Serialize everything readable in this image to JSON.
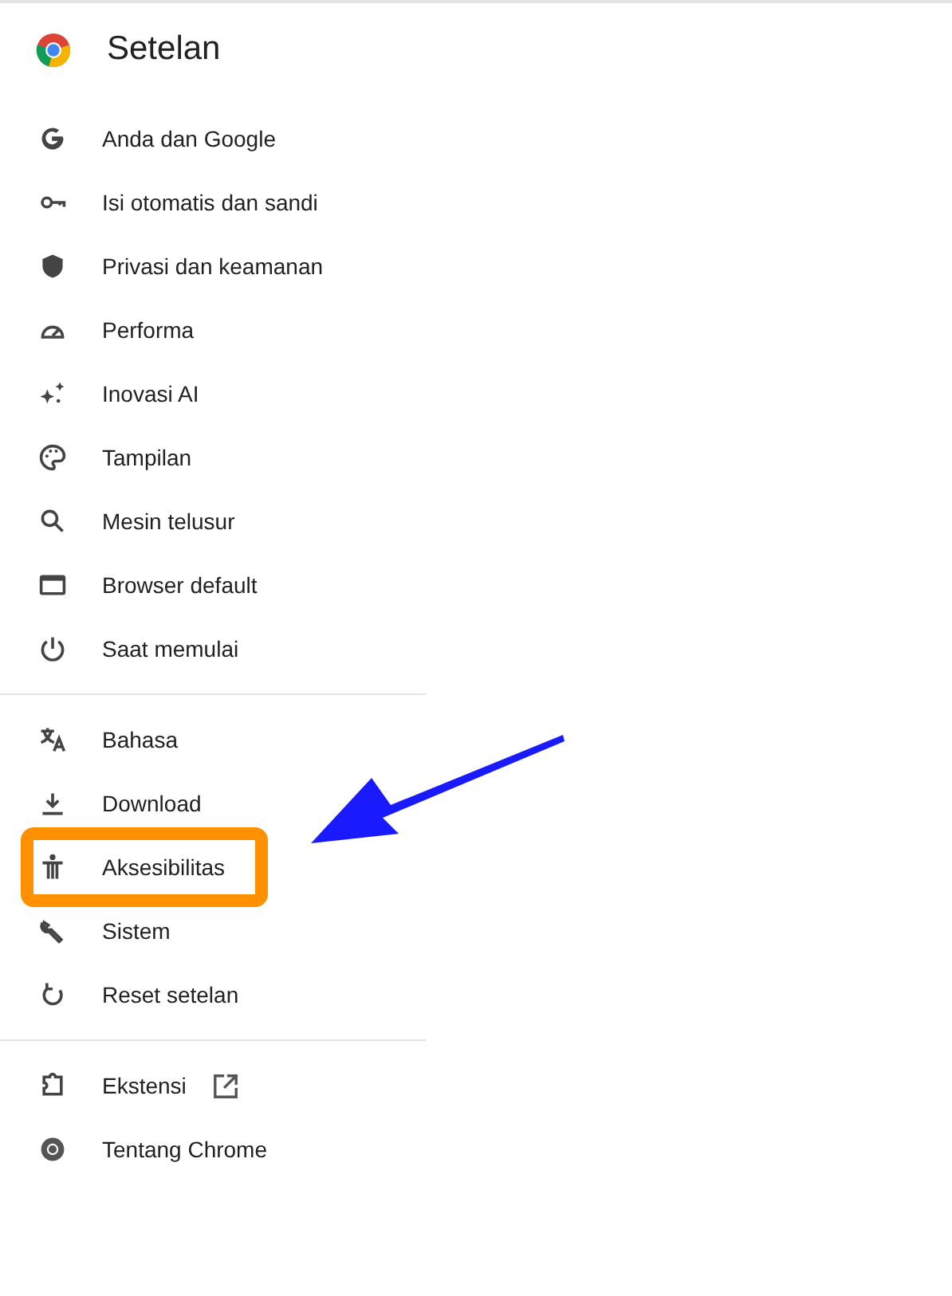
{
  "header": {
    "title": "Setelan"
  },
  "sections": [
    {
      "items": [
        {
          "label": "Anda dan Google",
          "highlighted": false
        },
        {
          "label": "Isi otomatis dan sandi",
          "highlighted": false
        },
        {
          "label": "Privasi dan keamanan",
          "highlighted": false
        },
        {
          "label": "Performa",
          "highlighted": false
        },
        {
          "label": "Inovasi AI",
          "highlighted": false
        },
        {
          "label": "Tampilan",
          "highlighted": false
        },
        {
          "label": "Mesin telusur",
          "highlighted": false
        },
        {
          "label": "Browser default",
          "highlighted": false
        },
        {
          "label": "Saat memulai",
          "highlighted": false
        }
      ]
    },
    {
      "items": [
        {
          "label": "Bahasa",
          "highlighted": false
        },
        {
          "label": "Download",
          "highlighted": false
        },
        {
          "label": "Aksesibilitas",
          "highlighted": true
        },
        {
          "label": "Sistem",
          "highlighted": false
        },
        {
          "label": "Reset setelan",
          "highlighted": false
        }
      ]
    },
    {
      "items": [
        {
          "label": "Ekstensi",
          "highlighted": false,
          "external": true
        },
        {
          "label": "Tentang Chrome",
          "highlighted": false
        }
      ]
    }
  ]
}
